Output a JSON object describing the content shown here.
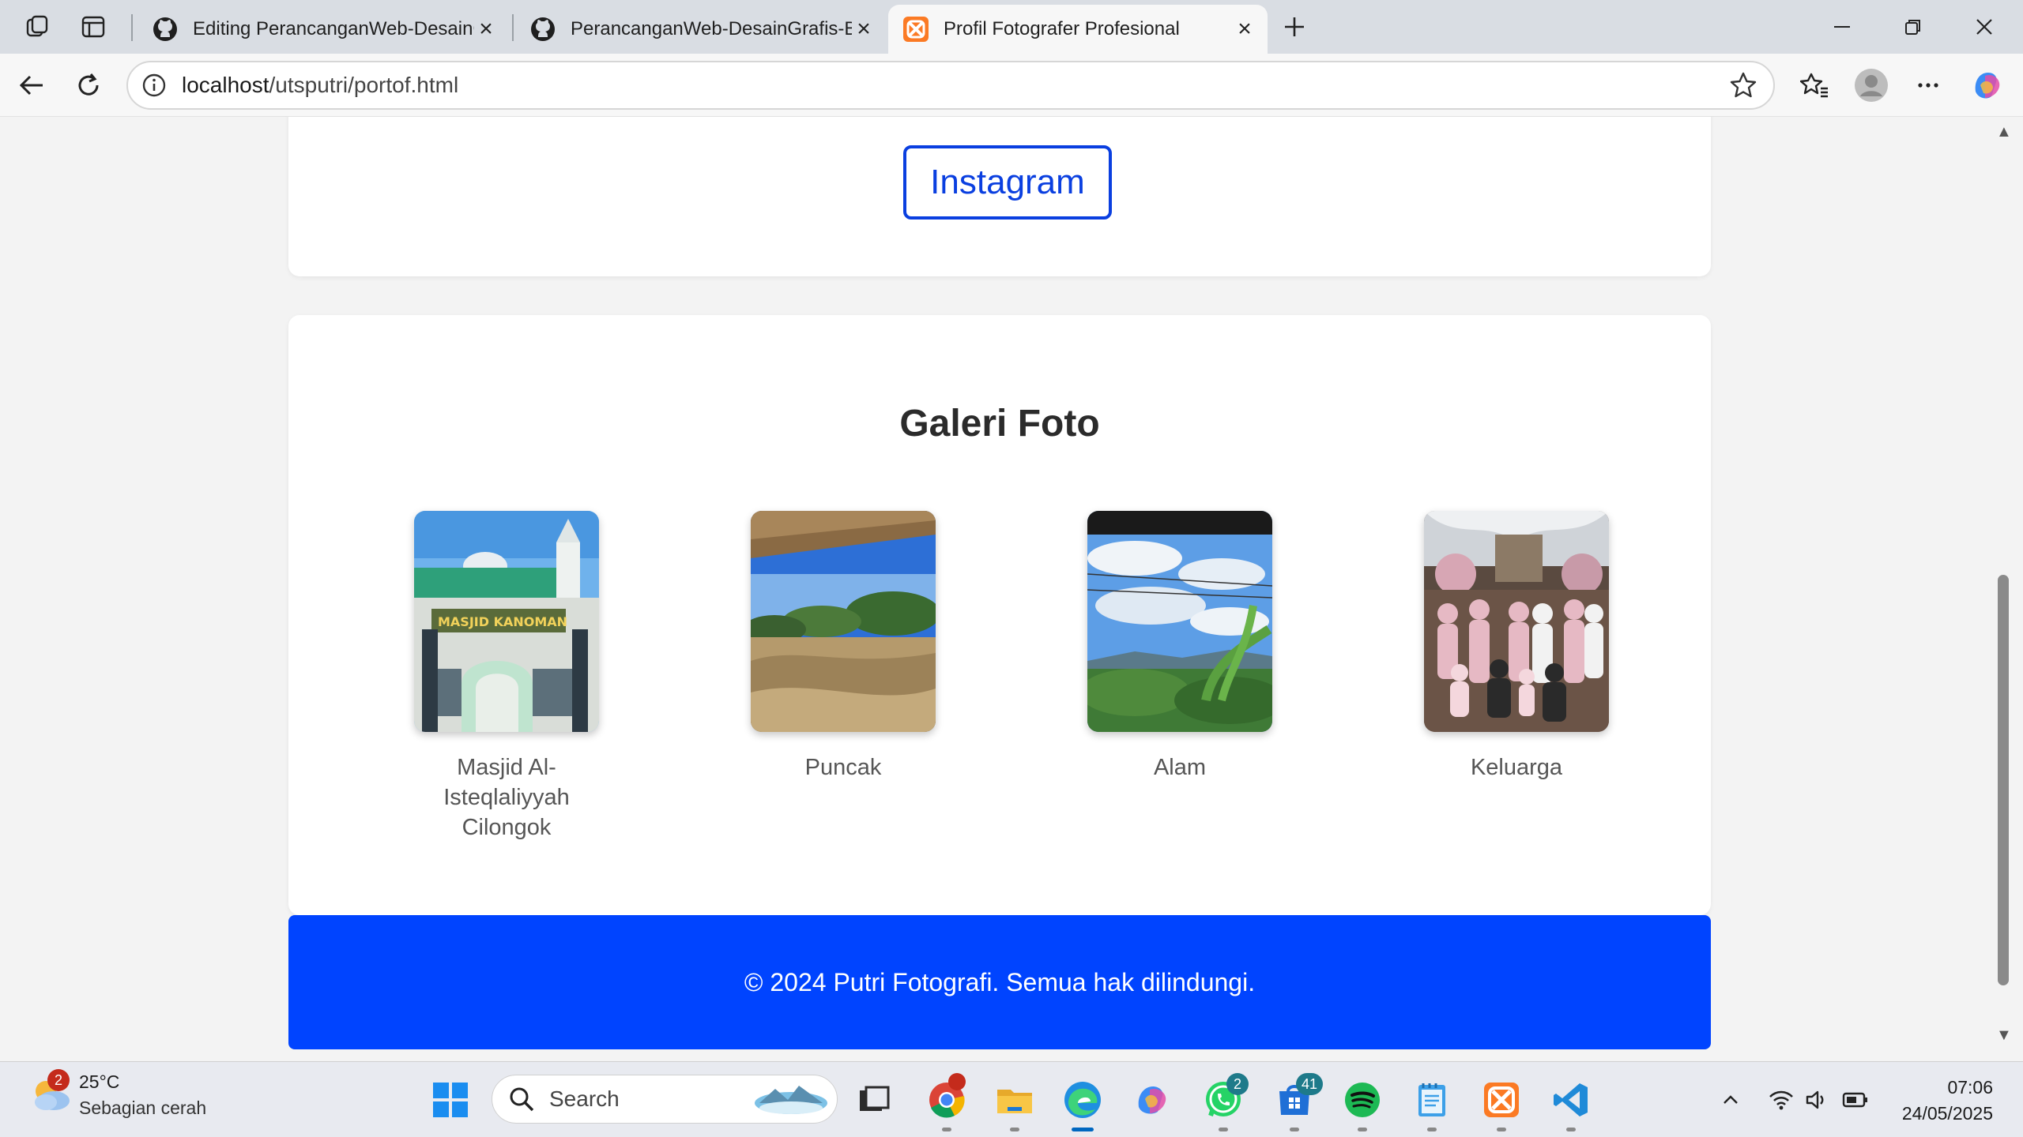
{
  "browser": {
    "tabs": [
      {
        "title": "Editing PerancanganWeb-DesainGrafis-Bi",
        "icon": "github-icon"
      },
      {
        "title": "PerancanganWeb-DesainGrafis-Bi",
        "icon": "github-icon"
      },
      {
        "title": "Profil Fotografer Profesional",
        "icon": "xampp-icon",
        "active": true
      }
    ],
    "address": {
      "host": "localhost",
      "path": "/utsputri/portof.html"
    }
  },
  "page": {
    "contact": {
      "instagram_label": "Instagram"
    },
    "gallery": {
      "title": "Galeri Foto",
      "items": [
        {
          "caption": "Masjid Al-Isteqlaliyyah Cilongok",
          "sign_text": "MASJID KANOMAN"
        },
        {
          "caption": "Puncak"
        },
        {
          "caption": "Alam"
        },
        {
          "caption": "Keluarga"
        }
      ]
    },
    "footer": {
      "text": "© 2024 Putri Fotografi. Semua hak dilindungi."
    }
  },
  "taskbar": {
    "weather": {
      "temp": "25°C",
      "condition": "Sebagian cerah",
      "badge": "2"
    },
    "search_placeholder": "Search",
    "badges": {
      "whatsapp": "2",
      "store": "41"
    },
    "clock": {
      "time": "07:06",
      "date": "24/05/2025"
    }
  },
  "colors": {
    "accent": "#0044ff",
    "link": "#0a3fe0"
  }
}
